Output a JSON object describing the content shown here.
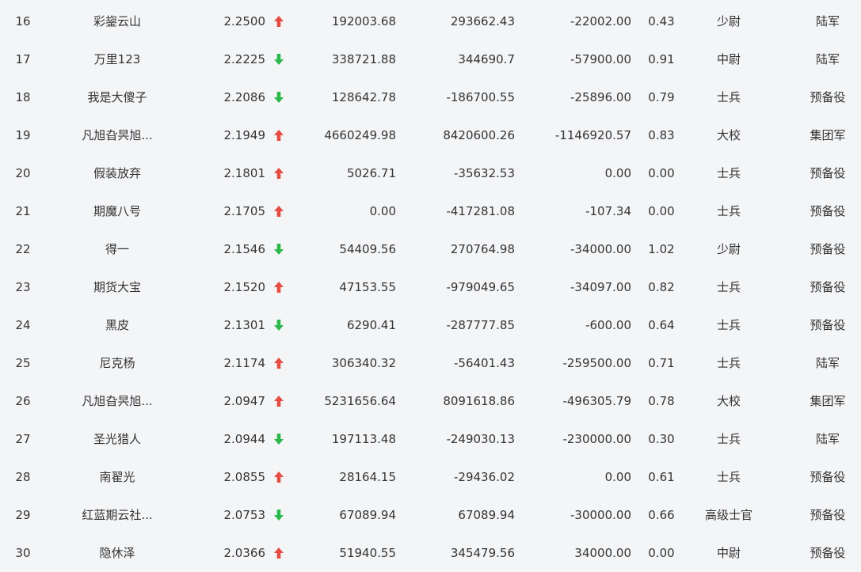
{
  "icons": {
    "up": "arrow-up-icon",
    "down": "arrow-down-icon"
  },
  "colors": {
    "up": "#e54d42",
    "down": "#2db84d",
    "background": "#f4f5f7",
    "text": "#333333"
  },
  "rows": [
    {
      "rank": "16",
      "name": "彩鋆云山",
      "score": "2.2500",
      "trend": "up",
      "v1": "192003.68",
      "v2": "293662.43",
      "v3": "-22002.00",
      "ratio": "0.43",
      "title": "少尉",
      "branch": "陆军"
    },
    {
      "rank": "17",
      "name": "万里123",
      "score": "2.2225",
      "trend": "down",
      "v1": "338721.88",
      "v2": "344690.7",
      "v3": "-57900.00",
      "ratio": "0.91",
      "title": "中尉",
      "branch": "陆军"
    },
    {
      "rank": "18",
      "name": "我是大傻子",
      "score": "2.2086",
      "trend": "down",
      "v1": "128642.78",
      "v2": "-186700.55",
      "v3": "-25896.00",
      "ratio": "0.79",
      "title": "士兵",
      "branch": "预备役"
    },
    {
      "rank": "19",
      "name": "凡旭旮昗旭...",
      "score": "2.1949",
      "trend": "up",
      "v1": "4660249.98",
      "v2": "8420600.26",
      "v3": "-1146920.57",
      "ratio": "0.83",
      "title": "大校",
      "branch": "集团军"
    },
    {
      "rank": "20",
      "name": "假装放弃",
      "score": "2.1801",
      "trend": "up",
      "v1": "5026.71",
      "v2": "-35632.53",
      "v3": "0.00",
      "ratio": "0.00",
      "title": "士兵",
      "branch": "预备役"
    },
    {
      "rank": "21",
      "name": "期魔八号",
      "score": "2.1705",
      "trend": "up",
      "v1": "0.00",
      "v2": "-417281.08",
      "v3": "-107.34",
      "ratio": "0.00",
      "title": "士兵",
      "branch": "预备役"
    },
    {
      "rank": "22",
      "name": "得一",
      "score": "2.1546",
      "trend": "down",
      "v1": "54409.56",
      "v2": "270764.98",
      "v3": "-34000.00",
      "ratio": "1.02",
      "title": "少尉",
      "branch": "预备役"
    },
    {
      "rank": "23",
      "name": "期货大宝",
      "score": "2.1520",
      "trend": "up",
      "v1": "47153.55",
      "v2": "-979049.65",
      "v3": "-34097.00",
      "ratio": "0.82",
      "title": "士兵",
      "branch": "预备役"
    },
    {
      "rank": "24",
      "name": "黑皮",
      "score": "2.1301",
      "trend": "down",
      "v1": "6290.41",
      "v2": "-287777.85",
      "v3": "-600.00",
      "ratio": "0.64",
      "title": "士兵",
      "branch": "预备役"
    },
    {
      "rank": "25",
      "name": "尼克杨",
      "score": "2.1174",
      "trend": "up",
      "v1": "306340.32",
      "v2": "-56401.43",
      "v3": "-259500.00",
      "ratio": "0.71",
      "title": "士兵",
      "branch": "陆军"
    },
    {
      "rank": "26",
      "name": "凡旭旮昗旭...",
      "score": "2.0947",
      "trend": "up",
      "v1": "5231656.64",
      "v2": "8091618.86",
      "v3": "-496305.79",
      "ratio": "0.78",
      "title": "大校",
      "branch": "集团军"
    },
    {
      "rank": "27",
      "name": "圣光猎人",
      "score": "2.0944",
      "trend": "down",
      "v1": "197113.48",
      "v2": "-249030.13",
      "v3": "-230000.00",
      "ratio": "0.30",
      "title": "士兵",
      "branch": "陆军"
    },
    {
      "rank": "28",
      "name": "南翟光",
      "score": "2.0855",
      "trend": "up",
      "v1": "28164.15",
      "v2": "-29436.02",
      "v3": "0.00",
      "ratio": "0.61",
      "title": "士兵",
      "branch": "预备役"
    },
    {
      "rank": "29",
      "name": "红蓝期云社...",
      "score": "2.0753",
      "trend": "down",
      "v1": "67089.94",
      "v2": "67089.94",
      "v3": "-30000.00",
      "ratio": "0.66",
      "title": "高级士官",
      "branch": "预备役"
    },
    {
      "rank": "30",
      "name": "隐休泽",
      "score": "2.0366",
      "trend": "up",
      "v1": "51940.55",
      "v2": "345479.56",
      "v3": "34000.00",
      "ratio": "0.00",
      "title": "中尉",
      "branch": "预备役"
    }
  ]
}
